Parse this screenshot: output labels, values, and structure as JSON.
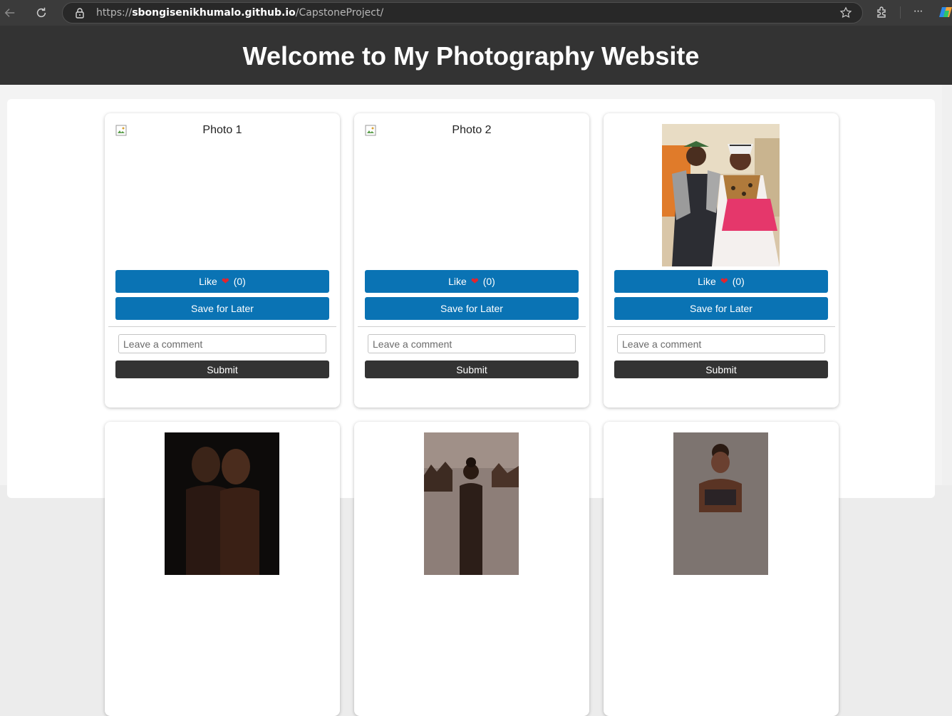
{
  "browser": {
    "url_scheme": "https://",
    "url_host": "sbongisenikhumalo.github.io",
    "url_path": "/CapstoneProject/",
    "icons": [
      "back-arrow-icon",
      "reload-icon",
      "lock-icon",
      "star-icon",
      "extensions-icon",
      "more-icon",
      "copilot-icon"
    ]
  },
  "site": {
    "title": "Welcome to My Photography Website"
  },
  "cards": [
    {
      "alt": "Photo 1",
      "like_label": "Like",
      "like_count": "(0)",
      "save_label": "Save for Later",
      "comment_placeholder": "Leave a comment",
      "submit_label": "Submit"
    },
    {
      "alt": "Photo 2",
      "like_label": "Like",
      "like_count": "(0)",
      "save_label": "Save for Later",
      "comment_placeholder": "Leave a comment",
      "submit_label": "Submit"
    },
    {
      "like_label": "Like",
      "like_count": "(0)",
      "save_label": "Save for Later",
      "comment_placeholder": "Leave a comment",
      "submit_label": "Submit"
    }
  ],
  "colors": {
    "header_bg": "#333333",
    "button_blue": "#0a73b4",
    "submit_dark": "#333333",
    "heart": "#e0242e"
  }
}
